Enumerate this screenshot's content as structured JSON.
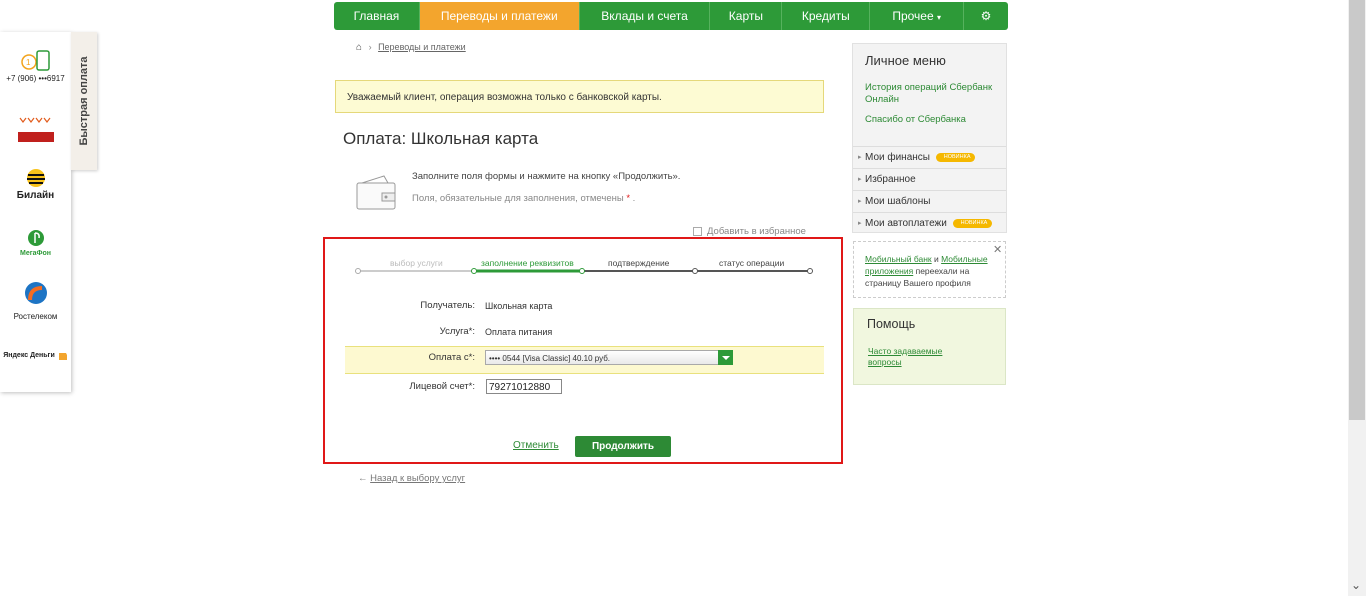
{
  "quick_pay": {
    "tab_label": "Быстрая оплата",
    "items": [
      {
        "label": "+7 (906) •••6917"
      },
      {
        "label": "Билайн"
      },
      {
        "label": "МегаФон"
      },
      {
        "label": "Ростелеком"
      },
      {
        "label": "Яндекс Деньги"
      }
    ]
  },
  "nav": [
    {
      "label": "Главная"
    },
    {
      "label": "Переводы и платежи"
    },
    {
      "label": "Вклады и счета"
    },
    {
      "label": "Карты"
    },
    {
      "label": "Кредиты"
    },
    {
      "label": "Прочее"
    }
  ],
  "breadcrumb": {
    "current": "Переводы и платежи"
  },
  "notice": "Уважаемый клиент, операция возможна только с банковской карты.",
  "page_title": "Оплата: Школьная карта",
  "hint_fill": "Заполните поля формы и нажмите на кнопку «Продолжить».",
  "hint_required": "Поля, обязательные для заполнения, отмечены",
  "hint_star": "*",
  "favorite_label": "Добавить в избранное",
  "steps": [
    {
      "label": "выбор услуги"
    },
    {
      "label": "заполнение реквизитов"
    },
    {
      "label": "подтверждение"
    },
    {
      "label": "статус операции"
    }
  ],
  "form": {
    "recipient_label": "Получатель:",
    "recipient_value": "Школьная карта",
    "service_label": "Услуга*:",
    "service_value": "Оплата питания",
    "pay_from_label": "Оплата с*:",
    "pay_from_value": "•••• 0544 [Visa Classic] 40.10 руб.",
    "account_label": "Лицевой счет*:",
    "account_value": "79271012880",
    "cancel_label": "Отменить",
    "continue_label": "Продолжить"
  },
  "back_link": "Назад к выбору услуг",
  "personal_menu": {
    "title": "Личное меню",
    "link_history": "История операций Сбербанк Онлайн",
    "link_thanks": "Спасибо от Сбербанка",
    "items": [
      {
        "label": "Мои финансы",
        "badge": "НОВИНКА"
      },
      {
        "label": "Избранное",
        "badge": ""
      },
      {
        "label": "Мои шаблоны",
        "badge": ""
      },
      {
        "label": "Мои автоплатежи",
        "badge": "НОВИНКА"
      }
    ]
  },
  "mobile_note": {
    "link1": "Мобильный банк",
    "and": " и ",
    "link2": "Мобильные приложения",
    "rest": " переехали на страницу Вашего профиля"
  },
  "help": {
    "title": "Помощь",
    "link": "Часто задаваемые вопросы"
  },
  "colors": {
    "brand_green": "#2d9a38",
    "active_orange": "#f3a52d",
    "highlight_red": "#e01818"
  }
}
